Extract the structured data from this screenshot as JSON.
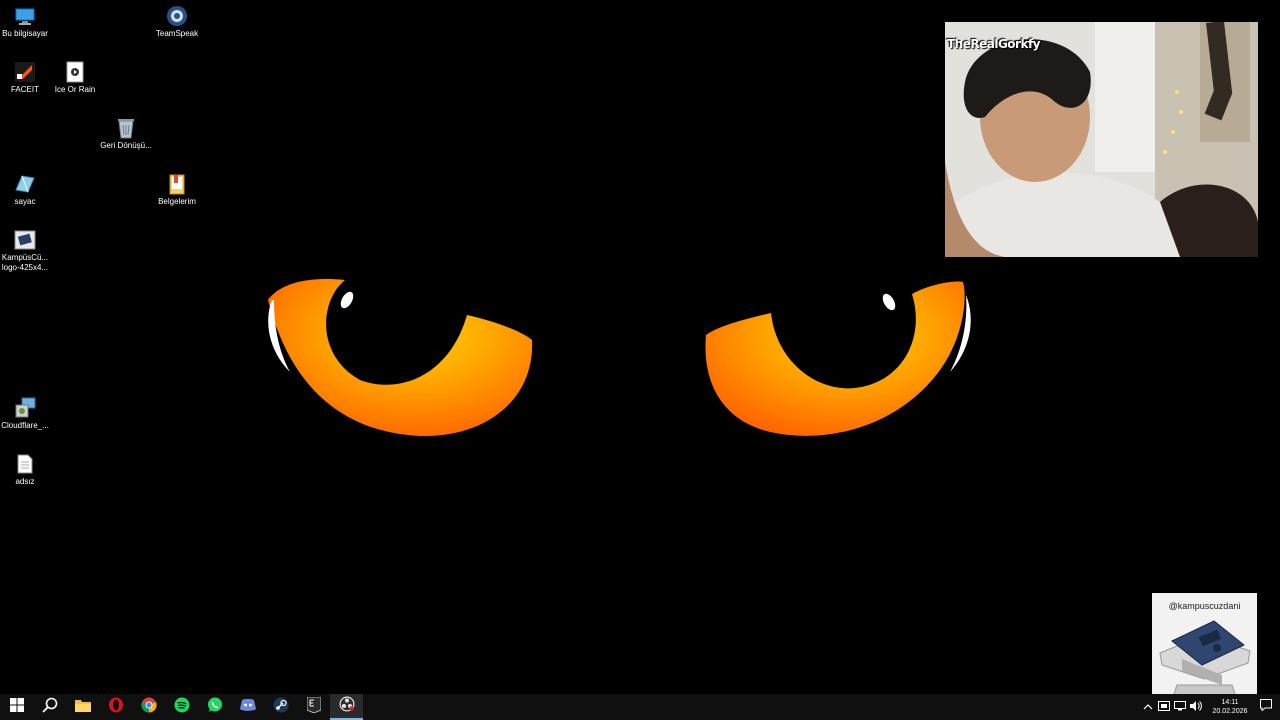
{
  "desktop": {
    "icons": [
      {
        "label": "Bu bilgisayar",
        "icon": "this-pc-icon"
      },
      {
        "label": "TeamSpeak",
        "icon": "teamspeak-icon"
      },
      {
        "label": "FACEIT",
        "icon": "faceit-icon"
      },
      {
        "label": "Ice Or Rain",
        "icon": "ice-or-rain-icon"
      },
      {
        "label": "Geri Dönüşü...",
        "icon": "recycle-bin-icon"
      },
      {
        "label": "sayac",
        "icon": "sayac-icon"
      },
      {
        "label": "Belgelerim",
        "icon": "documents-folder-icon"
      },
      {
        "label": "KampüsCü... logo-425x4...",
        "icon": "image-file-icon"
      },
      {
        "label": "Cloudflare_...",
        "icon": "cloudflare-installer-icon"
      },
      {
        "label": "adsız",
        "icon": "text-file-icon"
      }
    ]
  },
  "webcam": {
    "username": "TheRealGorkfy"
  },
  "promo": {
    "handle": "@kampuscuzdani"
  },
  "taskbar": {
    "apps": [
      "start-icon",
      "search-icon",
      "file-explorer-icon",
      "opera-icon",
      "chrome-icon",
      "spotify-icon",
      "whatsapp-icon",
      "discord-icon",
      "steam-icon",
      "epic-games-icon",
      "obs-icon"
    ],
    "clock": {
      "time": "14:11",
      "date": "20.02.2026"
    }
  },
  "colors": {
    "eye_outer": "#ff6a00",
    "eye_inner": "#ffd000",
    "taskbar_bg": "#101010",
    "active_indicator": "#76b9ed"
  }
}
